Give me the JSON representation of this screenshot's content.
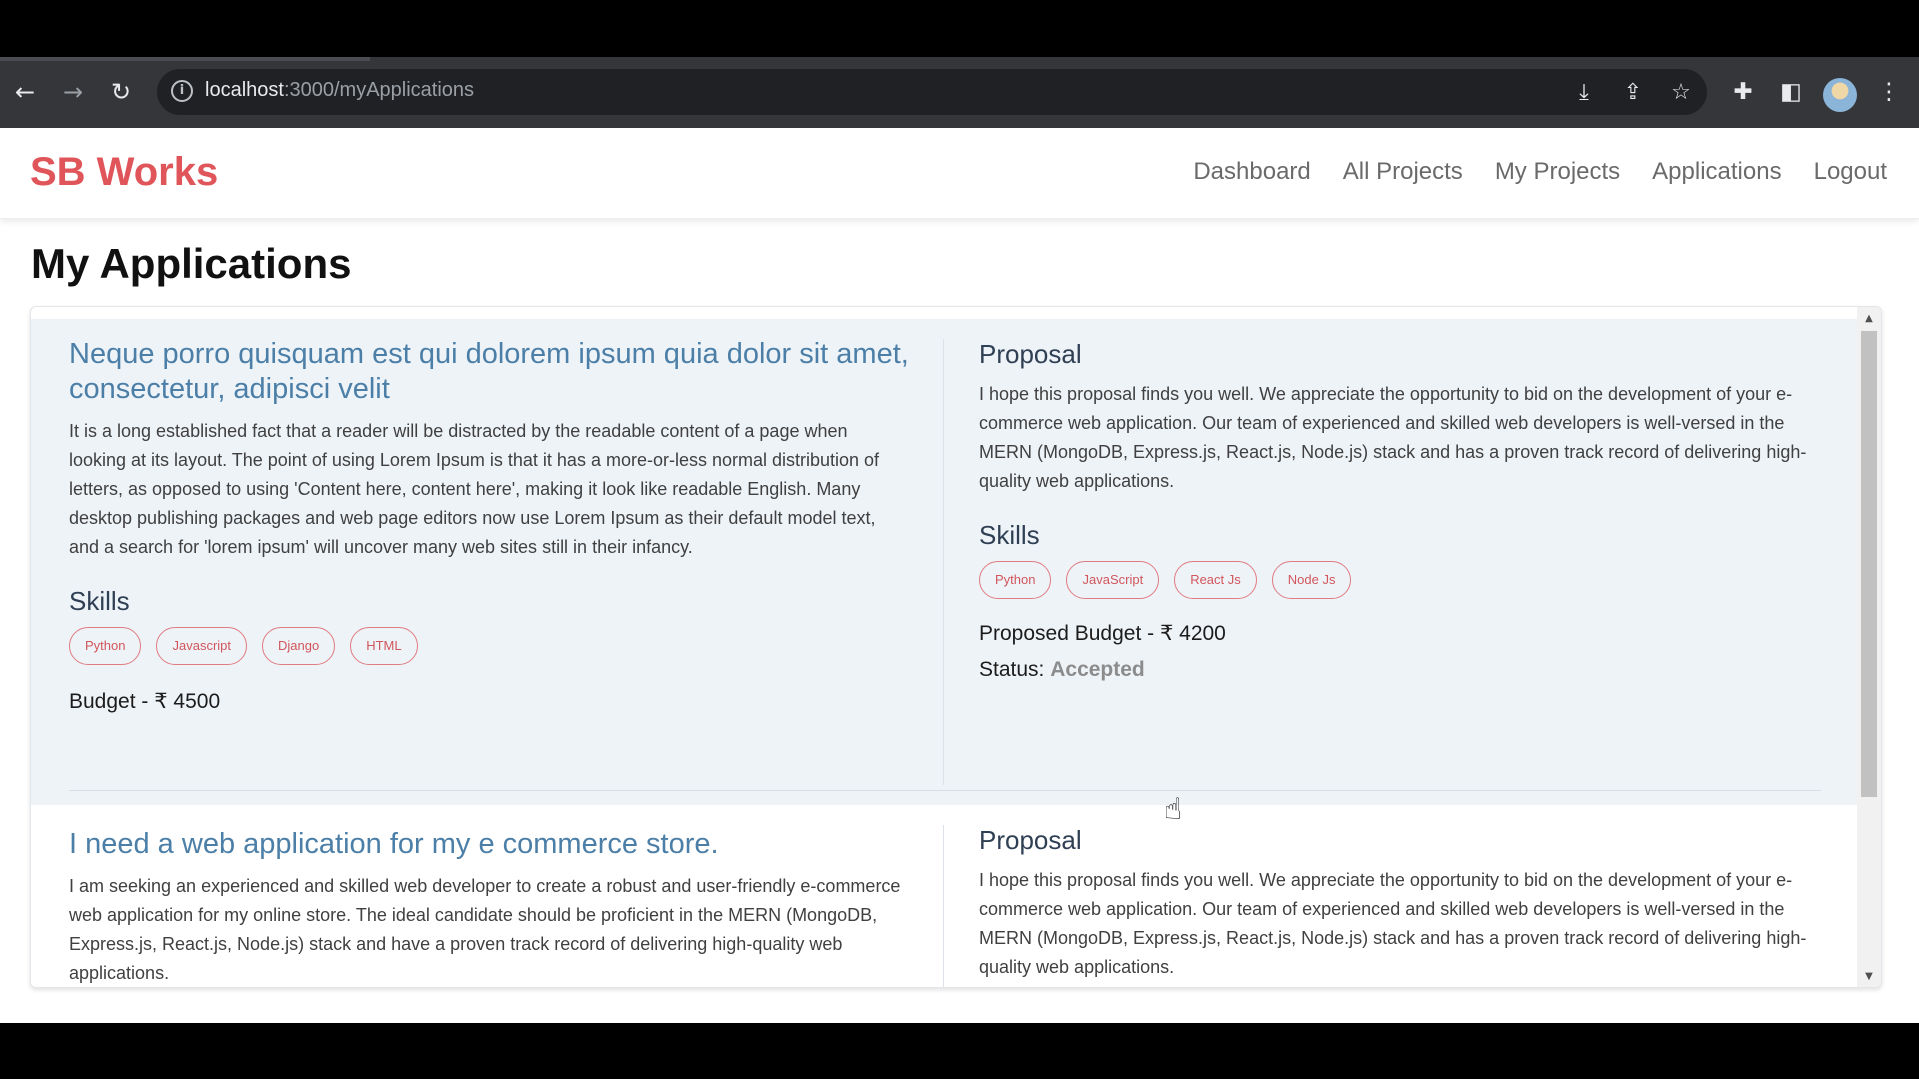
{
  "browser": {
    "url_host": "localhost",
    "url_path": ":3000/myApplications",
    "icons": [
      "back-icon",
      "forward-icon",
      "reload-icon",
      "info-icon",
      "install-icon",
      "share-icon",
      "bookmark-star-icon",
      "extensions-icon",
      "side-panel-icon",
      "profile-avatar",
      "menu-icon"
    ]
  },
  "nav": {
    "brand": "SB Works",
    "links": [
      "Dashboard",
      "All Projects",
      "My Projects",
      "Applications",
      "Logout"
    ]
  },
  "page": {
    "title": "My Applications"
  },
  "applications": [
    {
      "project_title": "Neque porro quisquam est qui dolorem ipsum quia dolor sit amet, consectetur, adipisci velit",
      "project_description": "It is a long established fact that a reader will be distracted by the readable content of a page when looking at its layout. The point of using Lorem Ipsum is that it has a more-or-less normal distribution of letters, as opposed to using 'Content here, content here', making it look like readable English. Many desktop publishing packages and web page editors now use Lorem Ipsum as their default model text, and a search for 'lorem ipsum' will uncover many web sites still in their infancy.",
      "skills_heading": "Skills",
      "project_skills": [
        "Python",
        "Javascript",
        "Django",
        "HTML"
      ],
      "budget_text": "Budget - ₹ 4500",
      "proposal_heading": "Proposal",
      "proposal_text": "I hope this proposal finds you well. We appreciate the opportunity to bid on the development of your e-commerce web application. Our team of experienced and skilled web developers is well-versed in the MERN (MongoDB, Express.js, React.js, Node.js) stack and has a proven track record of delivering high-quality web applications.",
      "proposal_skills_heading": "Skills",
      "proposal_skills": [
        "Python",
        "JavaScript",
        "React Js",
        "Node Js"
      ],
      "proposed_budget_text": "Proposed Budget - ₹ 4200",
      "status_label": "Status:",
      "status_value": "Accepted"
    },
    {
      "project_title": "I need a web application for my e commerce store.",
      "project_description": "I am seeking an experienced and skilled web developer to create a robust and user-friendly e-commerce web application for my online store. The ideal candidate should be proficient in the MERN (MongoDB, Express.js, React.js, Node.js) stack and have a proven track record of delivering high-quality web applications.",
      "proposal_heading": "Proposal",
      "proposal_text": "I hope this proposal finds you well. We appreciate the opportunity to bid on the development of your e-commerce web application. Our team of experienced and skilled web developers is well-versed in the MERN (MongoDB, Express.js, React.js, Node.js) stack and has a proven track record of delivering high-quality web applications."
    }
  ]
}
